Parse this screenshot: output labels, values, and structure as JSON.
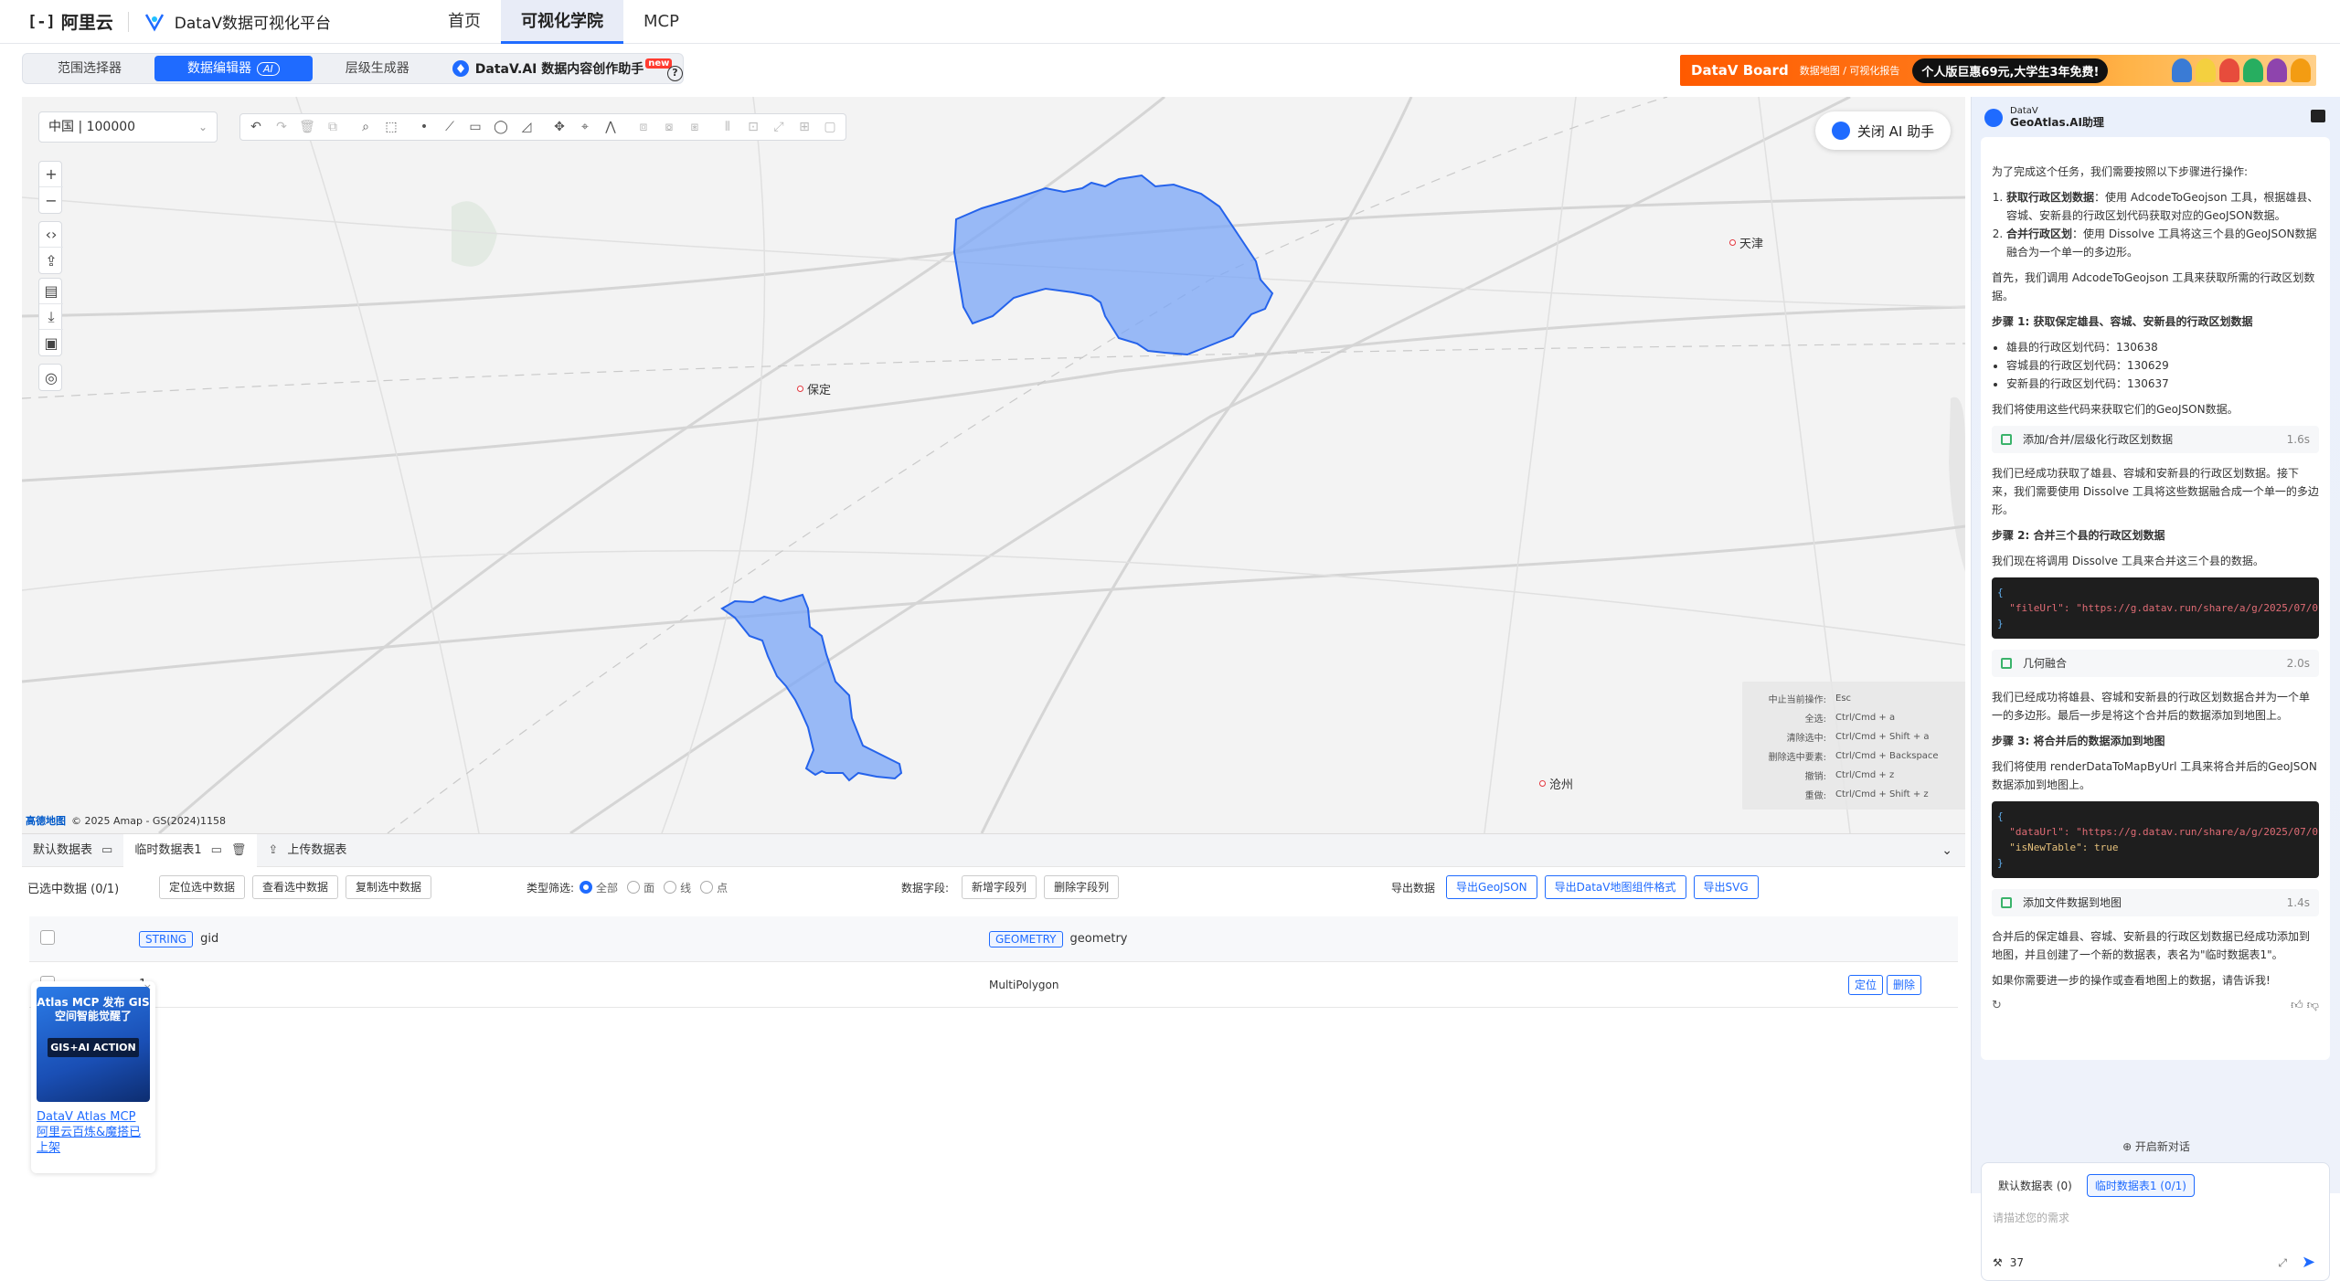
{
  "topnav": {
    "logo": "阿里云",
    "brand": "DataV数据可视化平台",
    "tabs": [
      {
        "label": "首页"
      },
      {
        "label": "可视化学院"
      },
      {
        "label": "MCP"
      }
    ]
  },
  "subbar": {
    "toggles": [
      {
        "label": "范围选择器"
      },
      {
        "label": "数据编辑器"
      },
      {
        "label": "层级生成器"
      }
    ],
    "ai_badge": "AI",
    "helper": "DataV.AI 数据内容创作助手",
    "new_badge": "new",
    "help": "?"
  },
  "promo": {
    "title": "DataV Board",
    "subtitle": "数据地图 / 可视化报告",
    "pill": "个人版巨惠69元,大学生3年免费!"
  },
  "map": {
    "region": "中国 | 100000",
    "ai_close": "关闭 AI 助手",
    "cities": [
      {
        "name": "天津"
      },
      {
        "name": "保定"
      },
      {
        "name": "沧州"
      }
    ],
    "shortcuts": [
      {
        "k": "中止当前操作:",
        "v": "Esc"
      },
      {
        "k": "全选:",
        "v": "Ctrl/Cmd + a"
      },
      {
        "k": "清除选中:",
        "v": "Ctrl/Cmd + Shift + a"
      },
      {
        "k": "删除选中要素:",
        "v": "Ctrl/Cmd + Backspace"
      },
      {
        "k": "撤销:",
        "v": "Ctrl/Cmd + z"
      },
      {
        "k": "重做:",
        "v": "Ctrl/Cmd + Shift + z"
      }
    ],
    "attribution": {
      "provider": "高德地图",
      "text": "© 2025 Amap - GS(2024)1158"
    }
  },
  "bottom": {
    "tabs": [
      {
        "label": "默认数据表"
      },
      {
        "label": "临时数据表1"
      },
      {
        "label": "上传数据表"
      }
    ],
    "selected": "已选中数据  (0/1)",
    "ops": [
      "定位选中数据",
      "查看选中数据",
      "复制选中数据"
    ],
    "type_filter": {
      "label": "类型筛选:",
      "options": [
        "全部",
        "面",
        "线",
        "点"
      ]
    },
    "fields": {
      "label": "数据字段:",
      "ops": [
        "新增字段列",
        "删除字段列"
      ]
    },
    "export": {
      "label": "导出数据",
      "ops": [
        "导出GeoJSON",
        "导出DataV地图组件格式",
        "导出SVG"
      ]
    },
    "columns": [
      {
        "type": "STRING",
        "name": "gid"
      },
      {
        "type": "GEOMETRY",
        "name": "geometry"
      }
    ],
    "rows": [
      {
        "gid": "1",
        "geometry": "MultiPolygon",
        "locate": "定位",
        "delete": "删除"
      }
    ]
  },
  "promo2": {
    "title": "Atlas MCP 发布 GIS 空间智能觉醒了",
    "action": "GIS+AI ACTION",
    "link": "DataV Atlas MCP 阿里云百炼&魔搭已上架",
    "close": "×"
  },
  "ai": {
    "header_top": "DataV",
    "header": "GeoAtlas.AI助理",
    "intro": "为了完成这个任务，我们需要按照以下步骤进行操作:",
    "steps": [
      {
        "bold": "获取行政区划数据",
        "text": "：使用 AdcodeToGeojson 工具，根据雄县、容城、安新县的行政区划代码获取对应的GeoJSON数据。"
      },
      {
        "bold": "合并行政区划",
        "text": "：使用 Dissolve 工具将这三个县的GeoJSON数据融合为一个单一的多边形。"
      }
    ],
    "first": "首先，我们调用 AdcodeToGeojson 工具来获取所需的行政区划数据。",
    "step1_title": "步骤 1: 获取保定雄县、容城、安新县的行政区划数据",
    "codes": [
      "雄县的行政区划代码：130638",
      "容城县的行政区划代码：130629",
      "安新县的行政区划代码：130637"
    ],
    "use_codes": "我们将使用这些代码来获取它们的GeoJSON数据。",
    "tool1": {
      "name": "添加/合并/层级化行政区划数据",
      "time": "1.6s"
    },
    "after1": "我们已经成功获取了雄县、容城和安新县的行政区划数据。接下来，我们需要使用 Dissolve 工具将这些数据融合成一个单一的多边形。",
    "step2_title": "步骤 2: 合并三个县的行政区划数据",
    "step2_text": "我们现在将调用 Dissolve 工具来合并这三个县的数据。",
    "code1": "\"fileUrl\": \"https://g.datav.run/share/a/g/2025/07/0",
    "tool2": {
      "name": "几何融合",
      "time": "2.0s"
    },
    "after2": "我们已经成功将雄县、容城和安新县的行政区划数据合并为一个单一的多边形。最后一步是将这个合并后的数据添加到地图上。",
    "step3_title": "步骤 3: 将合并后的数据添加到地图",
    "step3_text": "我们将使用 renderDataToMapByUrl 工具来将合并后的GeoJSON数据添加到地图上。",
    "code2a": "\"dataUrl\": \"https://g.datav.run/share/a/g/2025/07/0",
    "code2b": "\"isNewTable\": true",
    "tool3": {
      "name": "添加文件数据到地图",
      "time": "1.4s"
    },
    "final": "合并后的保定雄县、容城、安新县的行政区划数据已经成功添加到地图，并且创建了一个新的数据表，表名为\"临时数据表1\"。",
    "ask": "如果你需要进一步的操作或查看地图上的数据，请告诉我!",
    "open_new": "⊕ 开启新对话",
    "ds_default": "默认数据表 (0)",
    "ds_temp": "临时数据表1 (0/1)",
    "placeholder": "请描述您的需求",
    "count": "37"
  }
}
